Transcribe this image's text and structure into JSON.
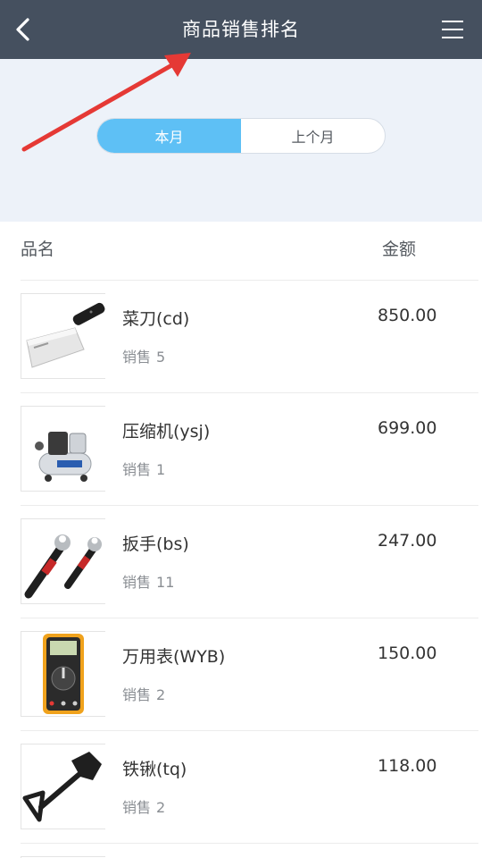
{
  "header": {
    "title": "商品销售排名",
    "back_icon": "chevron-left-icon",
    "menu_icon": "hamburger-menu-icon"
  },
  "period_tabs": {
    "active": "本月",
    "items": [
      "本月",
      "上个月"
    ]
  },
  "list": {
    "columns": {
      "name": "品名",
      "amount": "金额"
    },
    "sales_label": "销售",
    "items": [
      {
        "name": "菜刀(cd)",
        "sales": "5",
        "amount": "850.00",
        "image": "cleaver-knife"
      },
      {
        "name": "压缩机(ysj)",
        "sales": "1",
        "amount": "699.00",
        "image": "air-compressor"
      },
      {
        "name": "扳手(bs)",
        "sales": "11",
        "amount": "247.00",
        "image": "wrench"
      },
      {
        "name": "万用表(WYB)",
        "sales": "2",
        "amount": "150.00",
        "image": "multimeter"
      },
      {
        "name": "铁锹(tq)",
        "sales": "2",
        "amount": "118.00",
        "image": "shovel"
      }
    ]
  },
  "colors": {
    "header_bg": "#45505f",
    "tab_active": "#5ec0f5",
    "hero_bg": "#edf2f9",
    "annotation_arrow": "#e53935"
  }
}
